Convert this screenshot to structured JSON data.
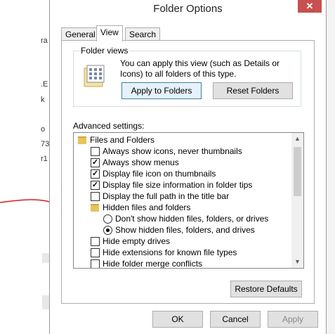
{
  "background": {
    "left_fragments": [
      "ra",
      ".E",
      "k",
      "o",
      "73",
      "r1"
    ]
  },
  "dialog": {
    "title": "Folder Options",
    "close_glyph": "✕",
    "tabs": [
      {
        "label": "General",
        "active": false
      },
      {
        "label": "View",
        "active": true
      },
      {
        "label": "Search",
        "active": false
      }
    ],
    "folder_views": {
      "label": "Folder views",
      "description": "You can apply this view (such as Details or Icons) to all folders of this type.",
      "apply_button": "Apply to Folders",
      "reset_button": "Reset Folders"
    },
    "advanced_label": "Advanced settings:",
    "settings": [
      {
        "type": "folder",
        "label": "Files and Folders",
        "level": 0
      },
      {
        "type": "checkbox",
        "label": "Always show icons, never thumbnails",
        "checked": false,
        "level": 1
      },
      {
        "type": "checkbox",
        "label": "Always show menus",
        "checked": true,
        "level": 1
      },
      {
        "type": "checkbox",
        "label": "Display file icon on thumbnails",
        "checked": true,
        "level": 1
      },
      {
        "type": "checkbox",
        "label": "Display file size information in folder tips",
        "checked": true,
        "level": 1
      },
      {
        "type": "checkbox",
        "label": "Display the full path in the title bar",
        "checked": false,
        "level": 1
      },
      {
        "type": "folder",
        "label": "Hidden files and folders",
        "level": 1
      },
      {
        "type": "radio",
        "label": "Don't show hidden files, folders, or drives",
        "checked": false,
        "level": 2
      },
      {
        "type": "radio",
        "label": "Show hidden files, folders, and drives",
        "checked": true,
        "level": 2
      },
      {
        "type": "checkbox",
        "label": "Hide empty drives",
        "checked": false,
        "level": 1
      },
      {
        "type": "checkbox",
        "label": "Hide extensions for known file types",
        "checked": false,
        "level": 1
      },
      {
        "type": "checkbox",
        "label": "Hide folder merge conflicts",
        "checked": false,
        "level": 1
      }
    ],
    "restore_button": "Restore Defaults",
    "ok_button": "OK",
    "cancel_button": "Cancel",
    "apply_button": "Apply"
  },
  "colors": {
    "close_button": "#c75050",
    "annotation": "#d42020",
    "folder_icon": "#e6c35c"
  }
}
